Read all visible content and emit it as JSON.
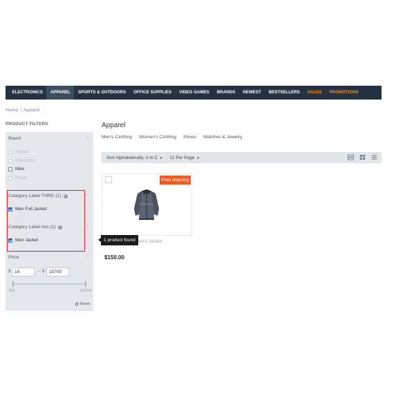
{
  "nav": {
    "items": [
      {
        "label": "ELECTRONICS"
      },
      {
        "label": "APPAREL"
      },
      {
        "label": "SPORTS & OUTDOORS"
      },
      {
        "label": "OFFICE SUPPLIES"
      },
      {
        "label": "VIDEO GAMES"
      },
      {
        "label": "BRANDS"
      },
      {
        "label": "NEWEST"
      },
      {
        "label": "BESTSELLERS"
      },
      {
        "label": "SALES"
      },
      {
        "label": "PROMOTIONS"
      }
    ],
    "active_item": "APPAREL",
    "highlight_color": "#f68b1f",
    "bar_color": "#243241"
  },
  "breadcrumb": {
    "home": "Home",
    "separator": "/",
    "current": "Apparel"
  },
  "filters": {
    "title": "PRODUCT FILTERS",
    "brand": {
      "label": "Brand",
      "options": [
        {
          "label": "Adidas",
          "state": "disabled"
        },
        {
          "label": "Montblanc",
          "state": "disabled"
        },
        {
          "label": "Nike",
          "state": "unchecked"
        },
        {
          "label": "Ricoh",
          "state": "disabled"
        }
      ]
    },
    "category_one": {
      "label": "Category Label THRE (1)",
      "option": "Men Full Jacket",
      "checked": true
    },
    "category_two": {
      "label": "Category Label two (1)",
      "option": "Men Jacket",
      "checked": true
    },
    "price": {
      "label": "Price",
      "currency": "$",
      "min_value": "16",
      "max_value": "10700",
      "separator": "—",
      "range_min": "$16",
      "range_max": "$10700",
      "reset": "Reset"
    }
  },
  "main": {
    "title": "Apparel",
    "subcategories": [
      "Men's Clothing",
      "Women's Clothing",
      "Shoes",
      "Watches & Jewelry"
    ],
    "sort_label": "Sort Alphabetically: A to Z",
    "per_page_label": "12 Per Page",
    "product": {
      "badge": "Free shipping",
      "name": "Super Runner Men's Jacket",
      "price": "$150.00"
    },
    "tooltip": "1 product found",
    "badge_color": "#f05a22"
  }
}
